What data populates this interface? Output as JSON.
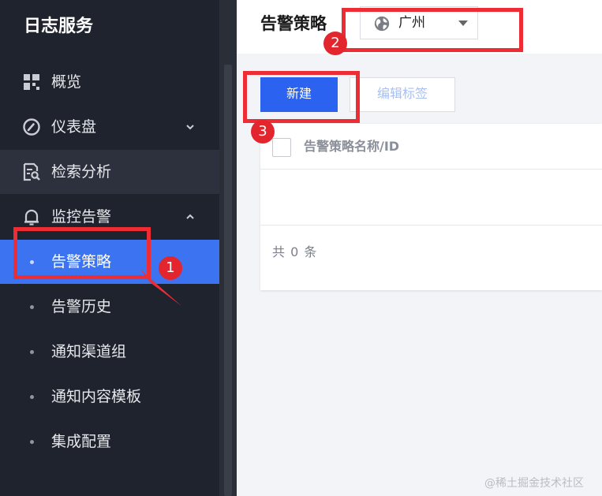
{
  "sidebar": {
    "brand": "日志服务",
    "items": [
      {
        "label": "概览",
        "icon": "grid-icon"
      },
      {
        "label": "仪表盘",
        "icon": "dashboard-gauge-icon",
        "expand": "chevron-down-icon"
      },
      {
        "label": "检索分析",
        "icon": "search-doc-icon"
      },
      {
        "label": "监控告警",
        "icon": "bell-icon",
        "expand": "chevron-up-icon"
      }
    ],
    "sub_items": [
      {
        "label": "告警策略",
        "selected": true
      },
      {
        "label": "告警历史"
      },
      {
        "label": "通知渠道组"
      },
      {
        "label": "通知内容模板"
      },
      {
        "label": "集成配置"
      }
    ]
  },
  "header": {
    "title": "告警策略",
    "region": {
      "label": "广州",
      "icon": "globe-icon"
    }
  },
  "toolbar": {
    "new_label": "新建",
    "edit_tags_label": "编辑标签"
  },
  "table": {
    "columns": [
      "告警策略名称/ID"
    ],
    "rows": [],
    "total": "共 0 条"
  },
  "annotations": [
    "1",
    "2",
    "3"
  ],
  "watermark": "@稀土掘金技术社区",
  "colors": {
    "sidebar_bg": "#1f232d",
    "selected": "#3b73f0",
    "primary_button": "#2b62f0",
    "annotation": "#ee2c34"
  }
}
